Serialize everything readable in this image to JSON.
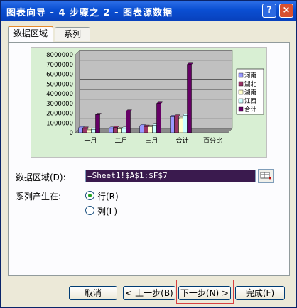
{
  "window": {
    "title": "图表向导 - 4 步骤之 2 - 图表源数据",
    "help_label": "?",
    "close_label": "×"
  },
  "tabs": [
    {
      "label": "数据区域"
    },
    {
      "label": "系列"
    }
  ],
  "data_range": {
    "label": "数据区域(D):",
    "value": "=Sheet1!$A$1:$F$7",
    "collapse_icon": "range-collapse-icon"
  },
  "series_in": {
    "label": "系列产生在:",
    "options": [
      {
        "label": "行(R)",
        "checked": true
      },
      {
        "label": "列(L)",
        "checked": false
      }
    ]
  },
  "buttons": {
    "cancel": "取消",
    "back": "< 上一步(B)",
    "next": "下一步(N) >",
    "finish": "完成(F)"
  },
  "colors": {
    "series": [
      "#9999ff",
      "#993366",
      "#ffffcc",
      "#ccffff",
      "#660066"
    ],
    "chart_bg": "#d8efd3",
    "plot_bg": "#c0c0c0"
  },
  "chart_data": {
    "type": "bar",
    "categories": [
      "一月",
      "二月",
      "三月",
      "合计",
      "百分比"
    ],
    "series": [
      {
        "name": "河南",
        "values": [
          500000,
          450000,
          700000,
          1650000,
          0
        ]
      },
      {
        "name": "湖北",
        "values": [
          450000,
          550000,
          650000,
          1700000,
          0
        ]
      },
      {
        "name": "湖南",
        "values": [
          300000,
          400000,
          600000,
          1450000,
          0
        ]
      },
      {
        "name": "江西",
        "values": [
          350000,
          450000,
          750000,
          1800000,
          0
        ]
      },
      {
        "name": "合计",
        "values": [
          1850000,
          2200000,
          3000000,
          7000000,
          0
        ]
      }
    ],
    "yticks": [
      0,
      1000000,
      2000000,
      3000000,
      4000000,
      5000000,
      6000000,
      7000000,
      8000000
    ],
    "ylim": [
      0,
      8000000
    ],
    "grid": true,
    "legend": "right"
  }
}
